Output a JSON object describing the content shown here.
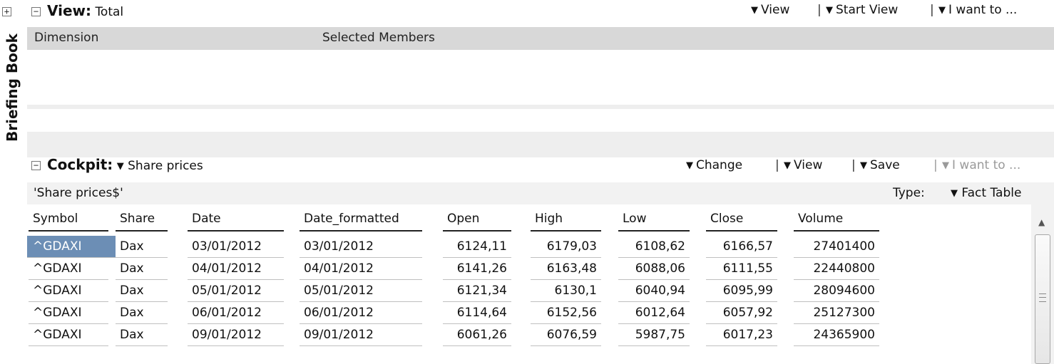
{
  "sidebar": {
    "label": "Briefing Book"
  },
  "view_section": {
    "title": "View:",
    "subtitle": "Total",
    "menu": {
      "view": "View",
      "start_view": "Start View",
      "i_want_to": "I want to ..."
    },
    "separator": "|",
    "header": {
      "dimension": "Dimension",
      "selected_members": "Selected Members"
    }
  },
  "cockpit_section": {
    "title": "Cockpit:",
    "selected_cockpit": "Share prices",
    "menu": {
      "change": "Change",
      "view": "View",
      "save": "Save",
      "i_want_to": "I want to ..."
    },
    "separator": "|",
    "source_name": "'Share prices$'",
    "type_label": "Type:",
    "type_value": "Fact Table"
  },
  "table": {
    "columns": [
      "Symbol",
      "Share",
      "Date",
      "Date_formatted",
      "Open",
      "High",
      "Low",
      "Close",
      "Volume"
    ],
    "rows": [
      [
        "^GDAXI",
        "Dax",
        "03/01/2012",
        "03/01/2012",
        "6124,11",
        "6179,03",
        "6108,62",
        "6166,57",
        "27401400"
      ],
      [
        "^GDAXI",
        "Dax",
        "04/01/2012",
        "04/01/2012",
        "6141,26",
        "6163,48",
        "6088,06",
        "6111,55",
        "22440800"
      ],
      [
        "^GDAXI",
        "Dax",
        "05/01/2012",
        "05/01/2012",
        "6121,34",
        "6130,1",
        "6040,94",
        "6095,99",
        "28094600"
      ],
      [
        "^GDAXI",
        "Dax",
        "06/01/2012",
        "06/01/2012",
        "6114,64",
        "6152,56",
        "6012,64",
        "6057,92",
        "25127300"
      ],
      [
        "^GDAXI",
        "Dax",
        "09/01/2012",
        "09/01/2012",
        "6061,26",
        "6076,59",
        "5987,75",
        "6017,23",
        "24365900"
      ]
    ],
    "selected_cell": "row 1, Symbol"
  },
  "icons": {
    "expand": "expand-icon",
    "collapse": "collapse-icon",
    "dropdown": "caret-down-icon",
    "scroll_up": "scroll-up-arrow-icon",
    "scroll_grip": "scroll-grip-icon"
  }
}
